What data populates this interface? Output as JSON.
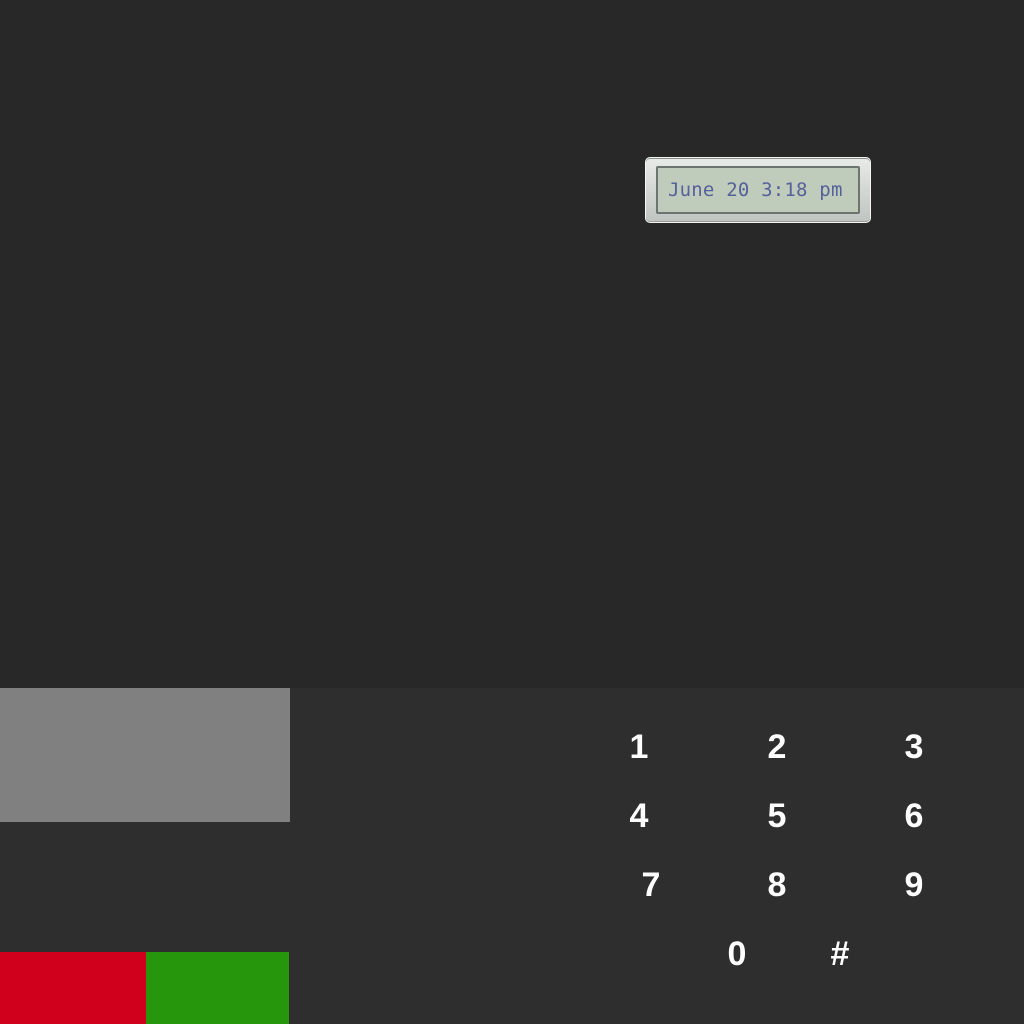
{
  "lcd": {
    "text": "June 20 3:18 pm"
  },
  "keypad": {
    "keys": [
      "1",
      "2",
      "3",
      "4",
      "5",
      "6",
      "7",
      "8",
      "9",
      "0",
      "#"
    ]
  },
  "colors": {
    "background": "#282828",
    "lower_panel": "#2e2e2e",
    "gray_panel": "#808080",
    "red_button": "#d0001c",
    "green_button": "#26970c"
  }
}
